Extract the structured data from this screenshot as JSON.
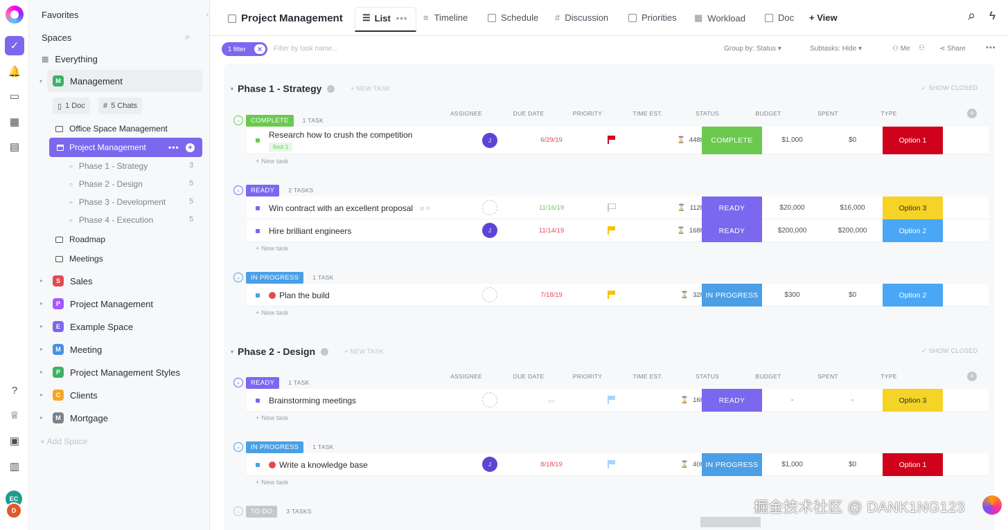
{
  "rail": {
    "icons": [
      "clickup-logo",
      "home-check-icon",
      "notifications-icon",
      "inbox-icon",
      "dashboards-icon",
      "docs-icon"
    ],
    "bottom_icons": [
      "help-icon",
      "goals-trophy-icon",
      "portfolio-icon",
      "clipboard-icon"
    ],
    "avatars": [
      {
        "initials": "EC",
        "color": "#1f9d8b"
      },
      {
        "initials": "D",
        "color": "#e2572b"
      }
    ]
  },
  "sidebar": {
    "favorites": "Favorites",
    "spaces": "Spaces",
    "everything": "Everything",
    "management": {
      "label": "Management",
      "initial": "M",
      "color": "#3db166"
    },
    "chips": {
      "doc": "1 Doc",
      "chats": "5 Chats"
    },
    "folders_top": [
      "Office Space Management"
    ],
    "active_list": "Project Management",
    "phases": [
      {
        "label": "Phase 1 - Strategy",
        "count": "3"
      },
      {
        "label": "Phase 2 - Design",
        "count": "5"
      },
      {
        "label": "Phase 3 - Development",
        "count": "5"
      },
      {
        "label": "Phase 4 - Execution",
        "count": "5"
      }
    ],
    "folders_bottom": [
      "Roadmap",
      "Meetings"
    ],
    "spaces_list": [
      {
        "initial": "S",
        "label": "Sales",
        "color": "#e5484d"
      },
      {
        "initial": "P",
        "label": "Project Management",
        "color": "#a259ff"
      },
      {
        "initial": "E",
        "label": "Example Space",
        "color": "#7b68ee"
      },
      {
        "initial": "M",
        "label": "Meeting",
        "color": "#4a90e2"
      },
      {
        "initial": "P",
        "label": "Project Management Styles",
        "color": "#3db166"
      },
      {
        "initial": "C",
        "label": "Clients",
        "color": "#f5a623"
      },
      {
        "initial": "M",
        "label": "Mortgage",
        "color": "#7c828d"
      }
    ],
    "add_space": "+ Add Space"
  },
  "header": {
    "title": "Project Management",
    "tabs": [
      "List",
      "Timeline",
      "Schedule",
      "Discussion",
      "Priorities",
      "Workload",
      "Doc"
    ],
    "add_view": "+ View"
  },
  "filterbar": {
    "filter_chip": "1 filter",
    "filter_close": "×",
    "search_placeholder": "Filter by task name...",
    "group_by": "Group by: Status",
    "subtasks": "Subtasks: Hide",
    "me": "Me",
    "share": "Share"
  },
  "columns": [
    "ASSIGNEE",
    "DUE DATE",
    "PRIORITY",
    "TIME EST.",
    "STATUS",
    "BUDGET",
    "SPENT",
    "TYPE"
  ],
  "phases": [
    {
      "title": "Phase 1 - Strategy",
      "new_task": "+ NEW TASK",
      "show_closed": "✓ SHOW CLOSED",
      "groups": [
        {
          "status": "COMPLETE",
          "count": "1 TASK",
          "color": "#6bc950",
          "tasks": [
            {
              "name": "Research how to crush the competition",
              "tag": "floor 1",
              "assignee": "J",
              "due": "6/29/19",
              "due_color": "#e5484d",
              "priority": "#d0021b",
              "time": "448h",
              "budget": "$1,000",
              "spent": "$0",
              "type": "Option 1",
              "type_color": "#d0021b",
              "type_text": "#fff"
            }
          ]
        },
        {
          "status": "READY",
          "count": "2 TASKS",
          "color": "#7b68ee",
          "tasks": [
            {
              "name": "Win contract with an excellent proposal",
              "tag": "",
              "assignee": "",
              "due": "11/16/19",
              "due_color": "#6bc950",
              "priority": "outline",
              "time": "112h",
              "budget": "$20,000",
              "spent": "$16,000",
              "type": "Option 3",
              "type_color": "#f5d327",
              "type_text": "#292d34"
            },
            {
              "name": "Hire brilliant engineers",
              "tag": "",
              "assignee": "J",
              "due": "11/14/19",
              "due_color": "#e5484d",
              "priority": "#f5c400",
              "time": "168h",
              "budget": "$200,000",
              "spent": "$200,000",
              "type": "Option 2",
              "type_color": "#49a7f5",
              "type_text": "#fff"
            }
          ]
        },
        {
          "status": "IN PROGRESS",
          "count": "1 TASK",
          "color": "#4a9fe6",
          "tasks": [
            {
              "name": "Plan the build",
              "tag": "",
              "assignee": "",
              "due": "7/18/19",
              "due_color": "#e5484d",
              "priority": "#f5c400",
              "time": "32h",
              "budget": "$300",
              "spent": "$0",
              "type": "Option 2",
              "type_color": "#49a7f5",
              "type_text": "#fff"
            }
          ]
        }
      ]
    },
    {
      "title": "Phase 2 - Design",
      "new_task": "+ NEW TASK",
      "show_closed": "✓ SHOW CLOSED",
      "groups": [
        {
          "status": "READY",
          "count": "1 TASK",
          "color": "#7b68ee",
          "tasks": [
            {
              "name": "Brainstorming meetings",
              "tag": "",
              "assignee": "",
              "due": "",
              "due_color": "#7c828d",
              "priority": "#a9d3ff",
              "time": "16h",
              "budget": "-",
              "spent": "-",
              "type": "Option 3",
              "type_color": "#f5d327",
              "type_text": "#292d34"
            }
          ]
        },
        {
          "status": "IN PROGRESS",
          "count": "1 TASK",
          "color": "#4a9fe6",
          "tasks": [
            {
              "name": "Write a knowledge base",
              "tag": "",
              "assignee": "J",
              "due": "8/18/19",
              "due_color": "#e5484d",
              "priority": "#a9d3ff",
              "time": "40h",
              "budget": "$1,000",
              "spent": "$0",
              "type": "Option 1",
              "type_color": "#d0021b",
              "type_text": "#fff"
            }
          ]
        },
        {
          "status": "TO DO",
          "count": "3 TASKS",
          "color": "#c4c7cc",
          "tasks": []
        }
      ]
    }
  ],
  "new_task": "+ New task",
  "watermark": "掘金技术社区 @ DANK1NG123"
}
